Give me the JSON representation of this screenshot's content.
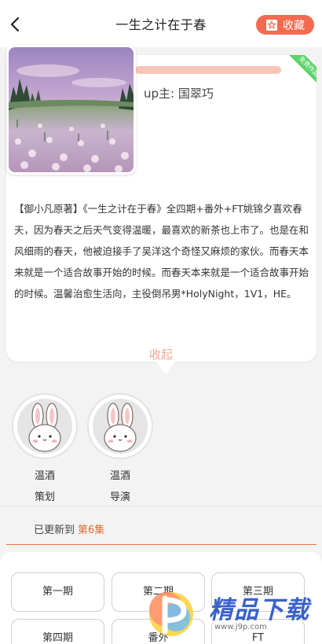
{
  "header": {
    "title": "一生之计在于春",
    "favorite_label": "收藏"
  },
  "book": {
    "badge": "免费作品",
    "up_author": "up主: 国翠巧",
    "description": "【御小凡原著】《一生之计在于春》全四期+番外+FT姚锦夕喜欢春天，因为春天之后天气变得温暖，最喜欢的新茶也上市了。也是在和风细雨的春天，他被迫接手了吴洋这个奇怪又麻烦的家伙。而春天本来就是一个适合故事开始的时候。而春天本来就是一个适合故事开始的时候。温馨治愈生活向，主役倒吊男*HolyNight，1V1，HE。",
    "collapse_label": "收起"
  },
  "staff": [
    {
      "name": "温酒",
      "role": "策划"
    },
    {
      "name": "温酒",
      "role": "导演"
    }
  ],
  "update": {
    "prefix": "已更新到",
    "episode": "第6集"
  },
  "episodes": [
    "第一期",
    "第二期",
    "第三期",
    "第四期",
    "番外",
    "FT"
  ],
  "watermark": {
    "text": "精品下载",
    "url": "www.j9p.com"
  },
  "colors": {
    "accent": "#f46a4f",
    "highlight": "#e26b2e",
    "badge": "#5bd36b"
  }
}
